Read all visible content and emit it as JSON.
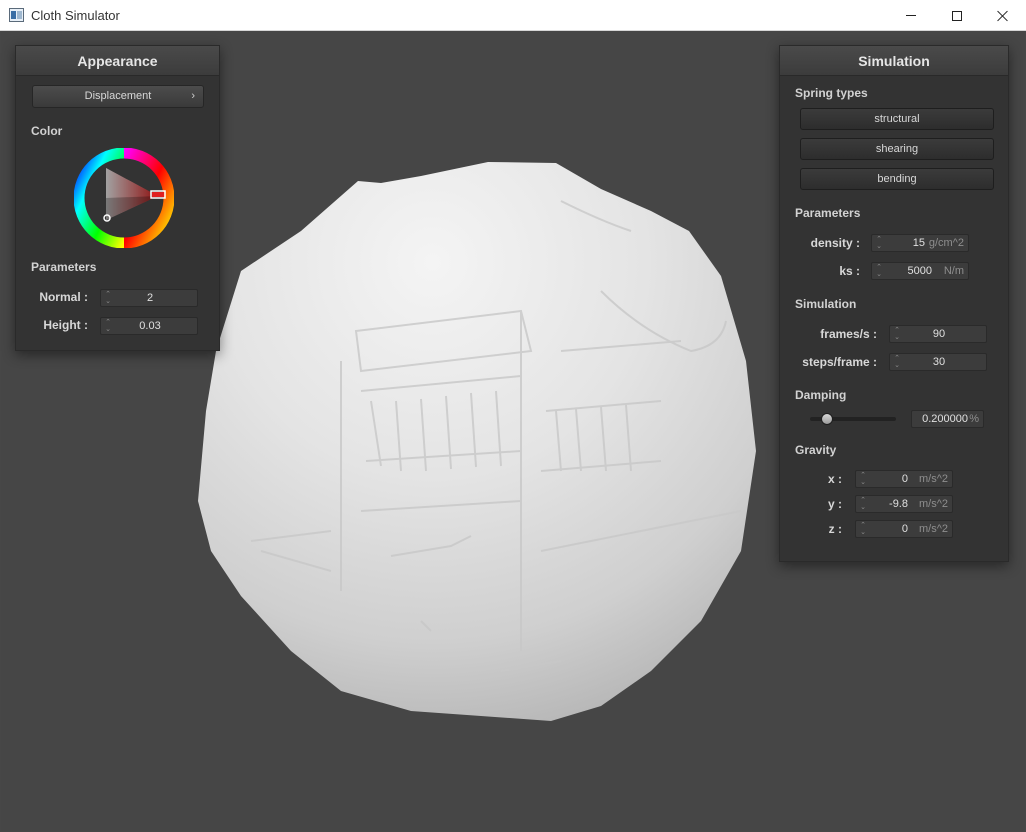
{
  "window": {
    "title": "Cloth Simulator"
  },
  "appearance": {
    "title": "Appearance",
    "shader_selected": "Displacement",
    "color_label": "Color",
    "color": "#b03030",
    "parameters_label": "Parameters",
    "normal": {
      "label": "Normal :",
      "value": "2"
    },
    "height": {
      "label": "Height :",
      "value": "0.03"
    }
  },
  "simulation": {
    "title": "Simulation",
    "spring_types_label": "Spring types",
    "spring_buttons": [
      "structural",
      "shearing",
      "bending"
    ],
    "parameters_label": "Parameters",
    "density": {
      "label": "density :",
      "value": "15",
      "unit": "g/cm^2"
    },
    "ks": {
      "label": "ks :",
      "value": "5000",
      "unit": "N/m"
    },
    "simulation_label": "Simulation",
    "fps": {
      "label": "frames/s :",
      "value": "90"
    },
    "steps": {
      "label": "steps/frame :",
      "value": "30"
    },
    "damping_label": "Damping",
    "damping": {
      "value": "0.200000",
      "unit": "%",
      "fraction": 0.2
    },
    "gravity_label": "Gravity",
    "gx": {
      "label": "x :",
      "value": "0",
      "unit": "m/s^2"
    },
    "gy": {
      "label": "y :",
      "value": "-9.8",
      "unit": "m/s^2"
    },
    "gz": {
      "label": "z :",
      "value": "0",
      "unit": "m/s^2"
    }
  }
}
